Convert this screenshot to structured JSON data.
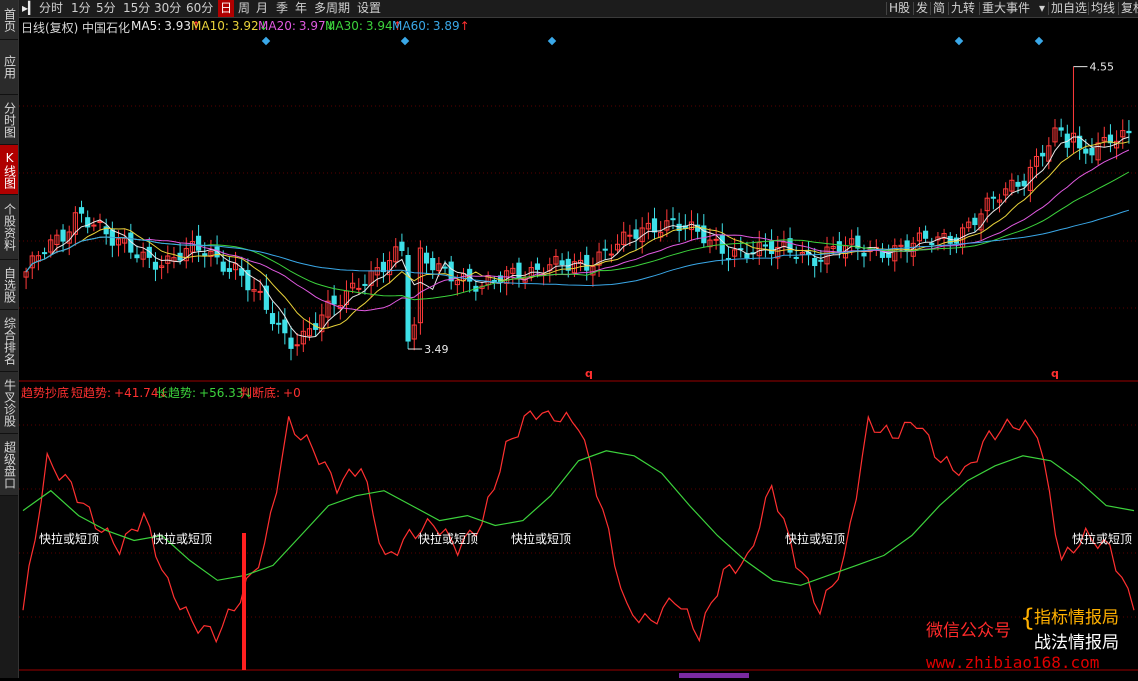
{
  "sidebar": {
    "items": [
      {
        "label": "首页",
        "active": false
      },
      {
        "label": "应用",
        "active": false
      },
      {
        "label": "分时图",
        "active": false
      },
      {
        "label": "K线图",
        "active": true
      },
      {
        "label": "个股资料",
        "active": false
      },
      {
        "label": "自选股",
        "active": false
      },
      {
        "label": "综合排名",
        "active": false
      },
      {
        "label": "牛叉诊股",
        "active": false
      },
      {
        "label": "超级盘口",
        "active": false
      }
    ]
  },
  "toolbar": {
    "left": [
      "分时",
      "1分",
      "5分",
      "15分",
      "30分",
      "60分",
      "日",
      "周",
      "月",
      "季",
      "年",
      "多周期",
      "设置"
    ],
    "active": "日",
    "right": [
      "H股",
      "发",
      "简",
      "九转",
      "重大事件",
      "加自选",
      "均线",
      "复权"
    ]
  },
  "main_legend": {
    "period": "日线(复权)",
    "stock": "中国石化",
    "ma": [
      {
        "label": "MA5:",
        "value": "3.93",
        "arrow": "↑",
        "color": "#e8e8e8"
      },
      {
        "label": "MA10:",
        "value": "3.92",
        "arrow": "↓",
        "color": "#e8d23a"
      },
      {
        "label": "MA20:",
        "value": "3.97",
        "arrow": "↓",
        "color": "#e05ae0"
      },
      {
        "label": "MA30:",
        "value": "3.94",
        "arrow": "↑",
        "color": "#3cd23c"
      },
      {
        "label": "MA60:",
        "value": "3.89",
        "arrow": "↑",
        "color": "#3aa8e8"
      }
    ]
  },
  "price_marks": {
    "high": "4.55",
    "low": "3.49"
  },
  "q_marker": "q",
  "indicator": {
    "name": "趋势抄底",
    "items": [
      {
        "label": "短趋势:",
        "value": "+41.74",
        "arrow": "↓",
        "color": "#ff3030"
      },
      {
        "label": "长趋势:",
        "value": "+56.33",
        "arrow": "↓",
        "color": "#3cd23c"
      },
      {
        "label": "判断底:",
        "value": "+0",
        "arrow": "",
        "color": "#ff3030"
      }
    ],
    "signal_label": "快拉或短顶"
  },
  "watermark": {
    "left": "微信公众号",
    "line1": "指标情报局",
    "line2": "战法情报局",
    "url": "www.zhibiao168.com",
    "colors": {
      "left": "#ff2a2a",
      "line1": "#ffb000",
      "line2": "#ffffff"
    }
  },
  "chart_data": {
    "type": "candlestick",
    "series": [
      {
        "name": "MA5",
        "color": "#e8e8e8"
      },
      {
        "name": "MA10",
        "color": "#e8d23a"
      },
      {
        "name": "MA20",
        "color": "#e05ae0"
      },
      {
        "name": "MA30",
        "color": "#3cd23c"
      },
      {
        "name": "MA60",
        "color": "#3aa8e8"
      }
    ],
    "ohlc_anchor_close": [
      3.78,
      3.85,
      3.9,
      4.02,
      3.96,
      3.88,
      3.86,
      3.84,
      3.82,
      3.84,
      3.86,
      3.83,
      3.8,
      3.7,
      3.6,
      3.52,
      3.56,
      3.62,
      3.66,
      3.74,
      3.8,
      3.84,
      3.85,
      3.82,
      3.8,
      3.75,
      3.7,
      3.76,
      3.8,
      3.78,
      3.79,
      3.8,
      3.82,
      3.86,
      3.88,
      3.92,
      3.96,
      3.98,
      3.93,
      3.88,
      3.86,
      3.87,
      3.86,
      3.85,
      3.86,
      3.84,
      3.86,
      3.86,
      3.86,
      3.87,
      3.87,
      3.88,
      3.9,
      3.92,
      3.97,
      4.02,
      4.08,
      4.14,
      4.24,
      4.3,
      4.2,
      4.26,
      4.3,
      4.28
    ]
  },
  "sub_chart_data": {
    "type": "line",
    "series": [
      {
        "name": "短趋势",
        "color": "#ff3030",
        "values": [
          20,
          80,
          70,
          55,
          45,
          58,
          30,
          15,
          10,
          25,
          45,
          95,
          85,
          70,
          78,
          40,
          50,
          55,
          45,
          55,
          85,
          100,
          98,
          95,
          60,
          20,
          15,
          25,
          10,
          35,
          40,
          70,
          40,
          20,
          40,
          95,
          90,
          96,
          80,
          75,
          90,
          95,
          92,
          40,
          50,
          45,
          20
        ]
      },
      {
        "name": "长趋势",
        "color": "#3cd23c",
        "values": [
          60,
          68,
          58,
          52,
          48,
          50,
          40,
          32,
          34,
          38,
          50,
          62,
          66,
          68,
          62,
          56,
          58,
          54,
          56,
          66,
          80,
          84,
          82,
          75,
          62,
          50,
          40,
          32,
          30,
          34,
          38,
          42,
          50,
          62,
          72,
          78,
          82,
          80,
          72,
          62,
          60
        ]
      },
      {
        "name": "判断底",
        "color": "#ff2020",
        "values": [
          0
        ]
      }
    ],
    "signal_labels": [
      "快拉或短顶",
      "快拉或短顶",
      "快拉或短顶",
      "快拉或短顶",
      "快拉或短顶",
      "快拉或短顶"
    ]
  }
}
